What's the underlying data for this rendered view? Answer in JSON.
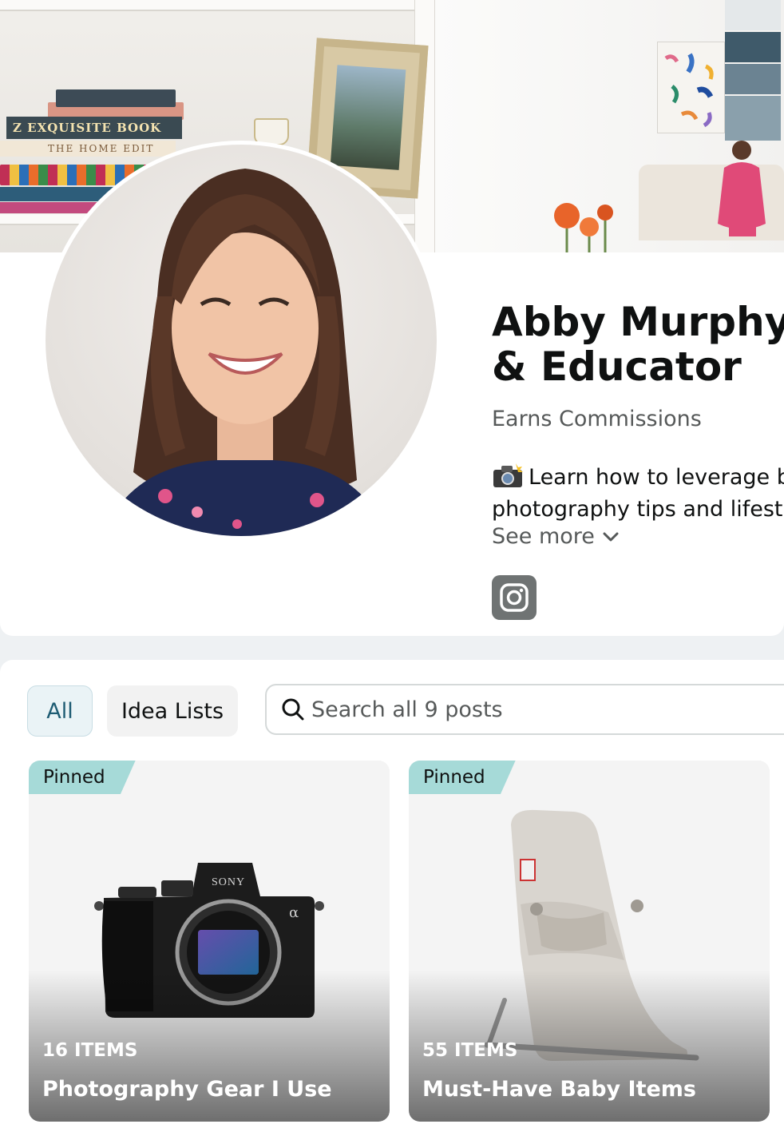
{
  "profile": {
    "name": "Abby Murphy\n& Educator",
    "earns_label": "Earns Commissions",
    "bio_line1": "Learn how to leverage b",
    "bio_line2": "photography tips and lifest",
    "see_more": "See more",
    "social_icon": "instagram-icon"
  },
  "filters": {
    "all": "All",
    "idea_lists": "Idea Lists",
    "active": "All"
  },
  "search": {
    "placeholder": "Search all 9 posts"
  },
  "cards": [
    {
      "badge": "Pinned",
      "count": "16 ITEMS",
      "title": "Photography Gear I Use",
      "image": "camera-image"
    },
    {
      "badge": "Pinned",
      "count": "55 ITEMS",
      "title": "Must-Have Baby Items",
      "image": "baby-bouncer-image"
    }
  ],
  "colors": {
    "pinned_badge": "#a6dad8",
    "active_filter_bg": "#eaf3f6",
    "active_filter_text": "#1e5c73",
    "instagram_bg": "#6f7373"
  }
}
